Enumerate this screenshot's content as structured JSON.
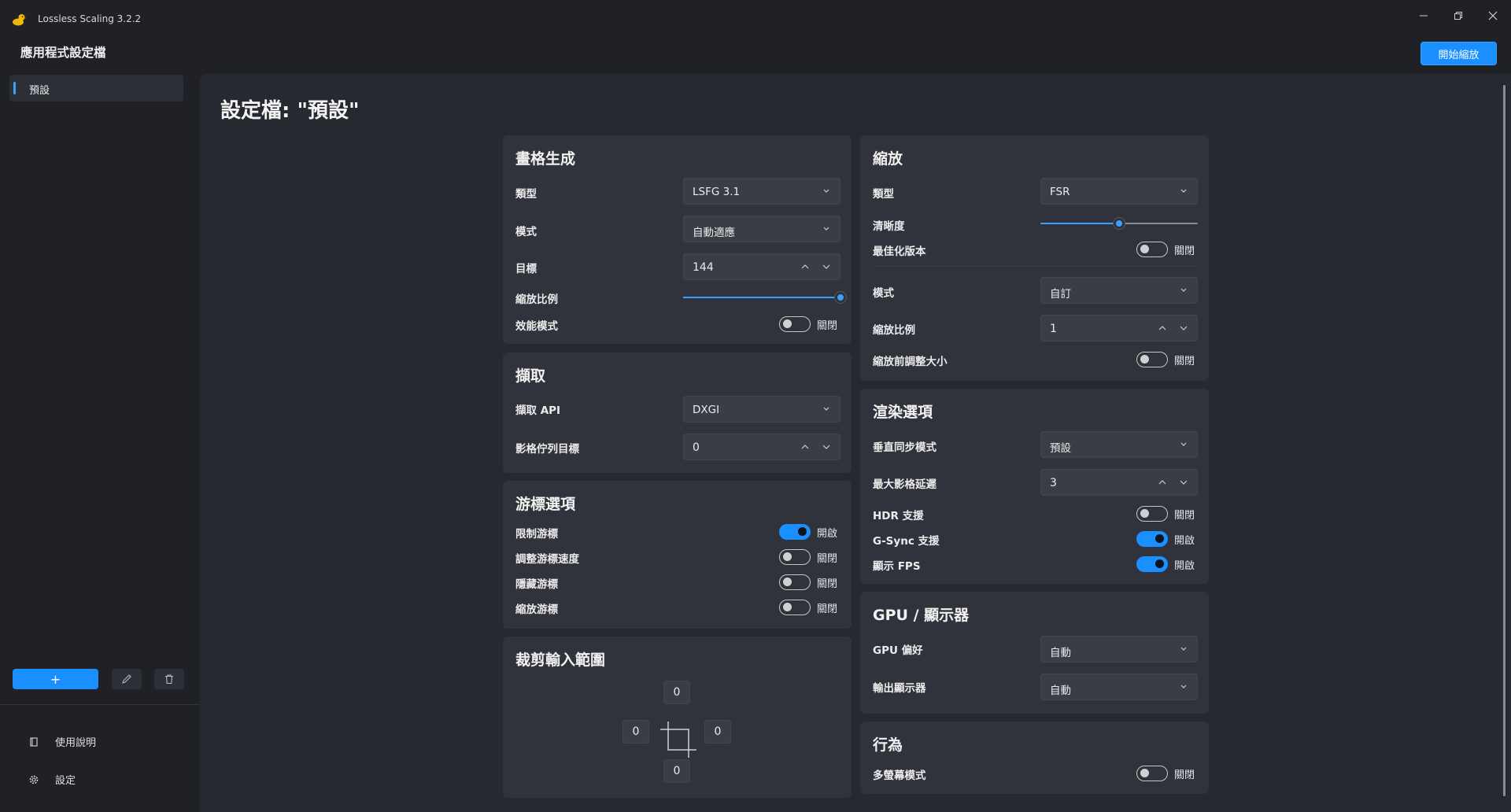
{
  "window": {
    "title": "Lossless Scaling 3.2.2",
    "controls": [
      "minimize",
      "restore",
      "close"
    ]
  },
  "header": {
    "section_title": "應用程式設定檔",
    "start_button": "開始縮放"
  },
  "sidebar": {
    "profiles": [
      {
        "label": "預設",
        "selected": true
      }
    ],
    "actions": {
      "add": "+",
      "edit_icon": "pencil-icon",
      "delete_icon": "trash-icon"
    },
    "footer": [
      {
        "label": "使用說明",
        "icon": "book-icon"
      },
      {
        "label": "設定",
        "icon": "gear-icon"
      }
    ]
  },
  "profile_title": "設定檔: \"預設\"",
  "frame_generation": {
    "title": "畫格生成",
    "type_label": "類型",
    "type_value": "LSFG 3.1",
    "mode_label": "模式",
    "mode_value": "自動適應",
    "target_label": "目標",
    "target_value": "144",
    "scale_label": "縮放比例",
    "scale_fraction": 1.0,
    "perf_label": "效能模式",
    "perf_state": "關閉",
    "perf_on": false
  },
  "capture": {
    "title": "擷取",
    "api_label": "擷取 API",
    "api_value": "DXGI",
    "queue_label": "影格佇列目標",
    "queue_value": "0"
  },
  "cursor": {
    "title": "游標選項",
    "items": [
      {
        "label": "限制游標",
        "state": "開啟",
        "on": true
      },
      {
        "label": "調整游標速度",
        "state": "關閉",
        "on": false
      },
      {
        "label": "隱藏游標",
        "state": "關閉",
        "on": false
      },
      {
        "label": "縮放游標",
        "state": "關閉",
        "on": false
      }
    ]
  },
  "crop": {
    "title": "裁剪輸入範圍",
    "top": "0",
    "left": "0",
    "right": "0",
    "bottom": "0"
  },
  "scaling": {
    "title": "縮放",
    "type_label": "類型",
    "type_value": "FSR",
    "sharpness_label": "清晰度",
    "sharpness_fraction": 0.5,
    "optimized_label": "最佳化版本",
    "optimized_state": "關閉",
    "optimized_on": false,
    "mode_label": "模式",
    "mode_value": "自訂",
    "factor_label": "縮放比例",
    "factor_value": "1",
    "resize_label": "縮放前調整大小",
    "resize_state": "關閉",
    "resize_on": false
  },
  "rendering": {
    "title": "渲染選項",
    "vsync_label": "垂直同步模式",
    "vsync_value": "預設",
    "latency_label": "最大影格延遲",
    "latency_value": "3",
    "hdr_label": "HDR 支援",
    "hdr_state": "關閉",
    "hdr_on": false,
    "gsync_label": "G-Sync 支援",
    "gsync_state": "開啟",
    "gsync_on": true,
    "fps_label": "顯示 FPS",
    "fps_state": "開啟",
    "fps_on": true
  },
  "gpu": {
    "title": "GPU / 顯示器",
    "pref_label": "GPU 偏好",
    "pref_value": "自動",
    "output_label": "輸出顯示器",
    "output_value": "自動"
  },
  "behavior": {
    "title": "行為",
    "multi_label": "多螢幕模式",
    "multi_state": "關閉",
    "multi_on": false
  },
  "colors": {
    "accent": "#1a8fff",
    "window_bg": "#202126",
    "content_bg": "#272931",
    "card_bg": "#30333b",
    "control_bg": "#3a3d45"
  }
}
